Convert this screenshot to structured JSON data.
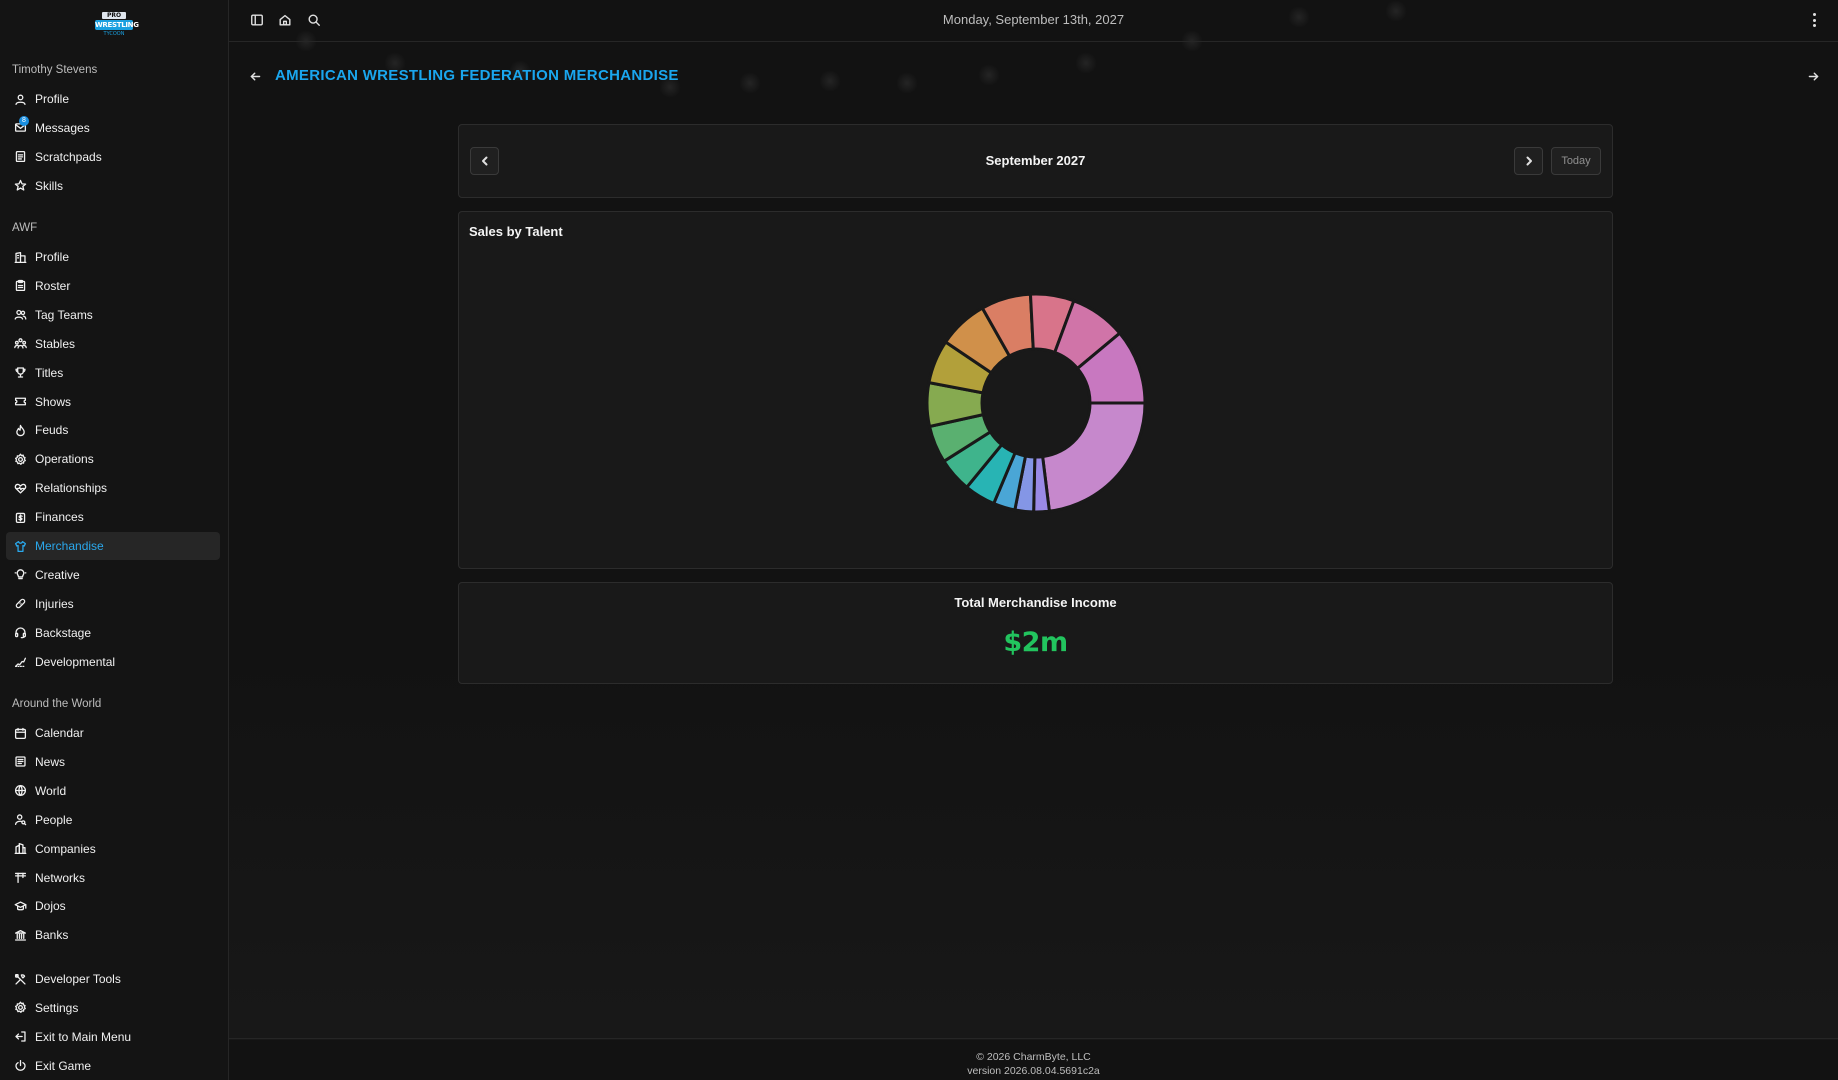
{
  "topbar": {
    "date": "Monday, September 13th, 2027"
  },
  "logo": {
    "line1": "PRO",
    "line2": "WRESTLING",
    "line3": "TYCOON"
  },
  "sidebar": {
    "user_section": "Timothy Stevens",
    "user_items": [
      {
        "label": "Profile",
        "icon": "user-icon"
      },
      {
        "label": "Messages",
        "icon": "mail-icon",
        "badge": "8"
      },
      {
        "label": "Scratchpads",
        "icon": "notepad-icon"
      },
      {
        "label": "Skills",
        "icon": "star-icon"
      }
    ],
    "company_section": "AWF",
    "company_items": [
      {
        "label": "Profile",
        "icon": "building-icon"
      },
      {
        "label": "Roster",
        "icon": "clipboard-icon"
      },
      {
        "label": "Tag Teams",
        "icon": "users-icon"
      },
      {
        "label": "Stables",
        "icon": "group-icon"
      },
      {
        "label": "Titles",
        "icon": "trophy-icon"
      },
      {
        "label": "Shows",
        "icon": "ticket-icon"
      },
      {
        "label": "Feuds",
        "icon": "flame-icon"
      },
      {
        "label": "Operations",
        "icon": "cog-icon"
      },
      {
        "label": "Relationships",
        "icon": "heart-network-icon"
      },
      {
        "label": "Finances",
        "icon": "money-icon"
      },
      {
        "label": "Merchandise",
        "icon": "shirt-icon",
        "active": true
      },
      {
        "label": "Creative",
        "icon": "lightbulb-icon"
      },
      {
        "label": "Injuries",
        "icon": "bandage-icon"
      },
      {
        "label": "Backstage",
        "icon": "headset-icon"
      },
      {
        "label": "Developmental",
        "icon": "growth-icon"
      }
    ],
    "world_section": "Around the World",
    "world_items": [
      {
        "label": "Calendar",
        "icon": "calendar-icon"
      },
      {
        "label": "News",
        "icon": "newspaper-icon"
      },
      {
        "label": "World",
        "icon": "globe-icon"
      },
      {
        "label": "People",
        "icon": "person-search-icon"
      },
      {
        "label": "Companies",
        "icon": "buildings-icon"
      },
      {
        "label": "Networks",
        "icon": "antenna-icon"
      },
      {
        "label": "Dojos",
        "icon": "school-icon"
      },
      {
        "label": "Banks",
        "icon": "bank-icon"
      }
    ],
    "system_items": [
      {
        "label": "Developer Tools",
        "icon": "tools-icon"
      },
      {
        "label": "Settings",
        "icon": "gear-icon"
      },
      {
        "label": "Exit to Main Menu",
        "icon": "exit-icon"
      },
      {
        "label": "Exit Game",
        "icon": "power-icon"
      }
    ]
  },
  "page": {
    "title": "AMERICAN WRESTLING FEDERATION MERCHANDISE"
  },
  "month_nav": {
    "label": "September 2027",
    "today_label": "Today"
  },
  "chart_data": {
    "type": "pie",
    "title": "Sales by Talent",
    "donut": true,
    "categories": [
      "",
      "",
      "",
      "",
      "",
      "",
      "",
      "",
      "",
      "",
      "",
      "",
      "",
      ""
    ],
    "values": [
      25,
      2.5,
      3,
      3.5,
      5,
      5.5,
      6,
      7,
      7,
      8,
      8,
      7,
      9,
      12
    ],
    "colors": [
      "#c688cc",
      "#9a8ae6",
      "#8496e6",
      "#4aa6d6",
      "#28b4b4",
      "#3fb48c",
      "#5ab070",
      "#86aa50",
      "#b2a03a",
      "#d0904a",
      "#da7e64",
      "#d8748a",
      "#d074a8",
      "#c878c0"
    ],
    "legend": "none"
  },
  "income": {
    "title": "Total Merchandise Income",
    "value": "$2m"
  },
  "footer": {
    "copyright": "© 2026 CharmByte, LLC",
    "version": "version 2026.08.04.5691c2a"
  }
}
